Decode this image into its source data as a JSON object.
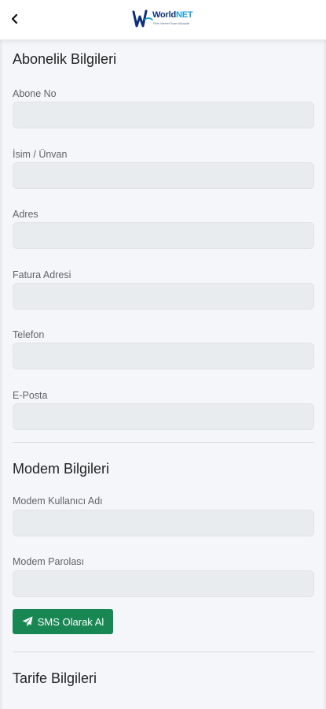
{
  "header": {
    "logo_main": "World",
    "logo_main_accent": "NET",
    "logo_tagline": "Fiber Internet Super Altyapılar"
  },
  "subscriber": {
    "title": "Abonelik Bilgileri",
    "fields": [
      {
        "label": "Abone No",
        "value": ""
      },
      {
        "label": "İsim / Ünvan",
        "value": ""
      },
      {
        "label": "Adres",
        "value": ""
      },
      {
        "label": "Fatura Adresi",
        "value": ""
      },
      {
        "label": "Telefon",
        "value": ""
      },
      {
        "label": "E-Posta",
        "value": ""
      }
    ]
  },
  "modem": {
    "title": "Modem Bilgileri",
    "fields": [
      {
        "label": "Modem Kullanıcı Adı",
        "value": ""
      },
      {
        "label": "Modem Parolası",
        "value": ""
      }
    ],
    "sms_button_label": "SMS Olarak Al"
  },
  "tariff": {
    "title": "Tarife Bilgileri"
  },
  "colors": {
    "accent_green": "#198754",
    "input_bg": "#e9ecef",
    "logo_navy": "#0d2f7a",
    "logo_cyan": "#1a9fd8"
  },
  "icons": {
    "back": "chevron-left-icon",
    "send": "paper-plane-icon"
  }
}
